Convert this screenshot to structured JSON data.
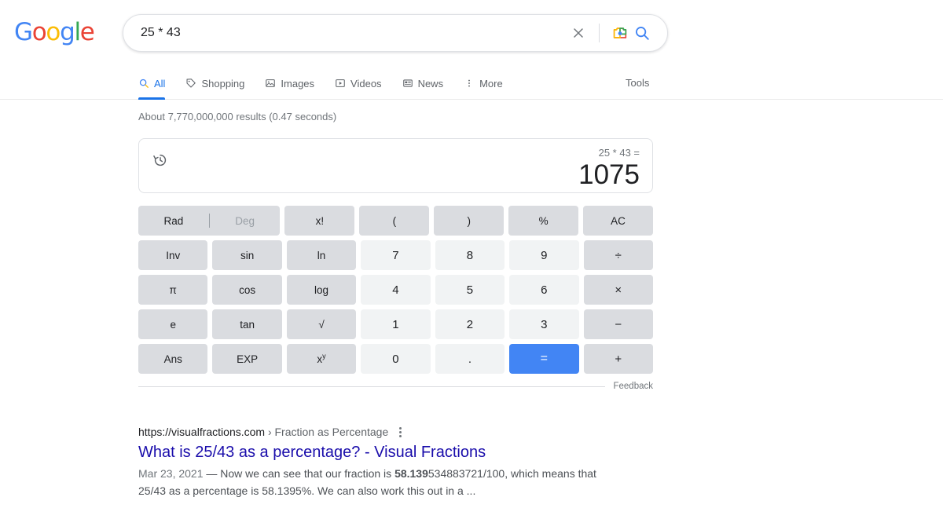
{
  "header": {
    "logo_letters": [
      {
        "c": "G",
        "color": "#4285f4"
      },
      {
        "c": "o",
        "color": "#ea4335"
      },
      {
        "c": "o",
        "color": "#fbbc05"
      },
      {
        "c": "g",
        "color": "#4285f4"
      },
      {
        "c": "l",
        "color": "#34a853"
      },
      {
        "c": "e",
        "color": "#ea4335"
      }
    ],
    "logo_text": "Google"
  },
  "search": {
    "query": "25 * 43",
    "placeholder": "Search",
    "clear_label": "×",
    "lens_icon": "camera-lens-icon",
    "search_icon": "search-icon"
  },
  "nav": {
    "tabs": [
      {
        "label": "All",
        "icon": "search-icon",
        "active": true
      },
      {
        "label": "Shopping",
        "icon": "tag-icon",
        "active": false
      },
      {
        "label": "Images",
        "icon": "image-icon",
        "active": false
      },
      {
        "label": "Videos",
        "icon": "video-icon",
        "active": false
      },
      {
        "label": "News",
        "icon": "news-icon",
        "active": false
      },
      {
        "label": "More",
        "icon": "more-vertical-icon",
        "active": false
      }
    ],
    "tools_label": "Tools",
    "active_color": "#1a73e8"
  },
  "results_count": "About 7,770,000,000 results (0.47 seconds)",
  "calculator": {
    "history_icon": "history-clock-icon",
    "expression": "25 * 43 =",
    "answer": "1075",
    "mode": {
      "rad": "Rad",
      "deg": "Deg",
      "active": "Rad"
    },
    "keys": [
      [
        {
          "label": "RADEG",
          "type": "radeg"
        },
        {
          "label": "x!",
          "type": "fn"
        },
        {
          "label": "(",
          "type": "fn"
        },
        {
          "label": ")",
          "type": "fn"
        },
        {
          "label": "%",
          "type": "fn"
        },
        {
          "label": "AC",
          "type": "fn"
        }
      ],
      [
        {
          "label": "Inv",
          "type": "fn"
        },
        {
          "label": "sin",
          "type": "fn"
        },
        {
          "label": "ln",
          "type": "fn"
        },
        {
          "label": "7",
          "type": "num"
        },
        {
          "label": "8",
          "type": "num"
        },
        {
          "label": "9",
          "type": "num"
        },
        {
          "label": "÷",
          "type": "op"
        }
      ],
      [
        {
          "label": "π",
          "type": "fn"
        },
        {
          "label": "cos",
          "type": "fn"
        },
        {
          "label": "log",
          "type": "fn"
        },
        {
          "label": "4",
          "type": "num"
        },
        {
          "label": "5",
          "type": "num"
        },
        {
          "label": "6",
          "type": "num"
        },
        {
          "label": "×",
          "type": "op"
        }
      ],
      [
        {
          "label": "e",
          "type": "fn"
        },
        {
          "label": "tan",
          "type": "fn"
        },
        {
          "label": "√",
          "type": "fn"
        },
        {
          "label": "1",
          "type": "num"
        },
        {
          "label": "2",
          "type": "num"
        },
        {
          "label": "3",
          "type": "num"
        },
        {
          "label": "−",
          "type": "op"
        }
      ],
      [
        {
          "label": "Ans",
          "type": "fn"
        },
        {
          "label": "EXP",
          "type": "fn"
        },
        {
          "label": "xy",
          "type": "pow"
        },
        {
          "label": "0",
          "type": "num"
        },
        {
          "label": ".",
          "type": "num"
        },
        {
          "label": "=",
          "type": "eq"
        },
        {
          "label": "+",
          "type": "op"
        }
      ]
    ],
    "equals_color": "#4285f4",
    "feedback_label": "Feedback"
  },
  "organic_result": {
    "url_domain": "https://visualfractions.com",
    "url_crumb": "› Fraction as Percentage",
    "title": "What is 25/43 as a percentage? - Visual Fractions",
    "date": "Mar 23, 2021",
    "snippet_pre": " — Now we can see that our fraction is ",
    "snippet_bold": "58.139",
    "snippet_post": "534883721/100, which means that 25/43 as a percentage is 58.1395%. We can also work this out in a ...",
    "title_color": "#1a0dab"
  }
}
